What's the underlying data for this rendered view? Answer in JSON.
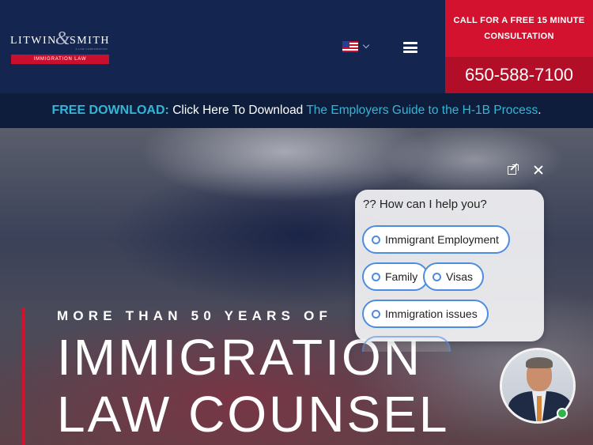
{
  "header": {
    "logo": {
      "name_left": "LITWIN",
      "name_right": "SMITH",
      "ampersand": "&",
      "tagline": "IMMIGRATION LAW",
      "sub": "A LAW CORPORATION"
    },
    "language": {
      "flag": "us-flag-icon",
      "selected": "English"
    },
    "menu_icon": "hamburger-menu-icon",
    "cta": {
      "text": "CALL FOR A FREE 15 MINUTE CONSULTATION",
      "phone": "650-588-7100"
    }
  },
  "download_bar": {
    "label": "FREE DOWNLOAD:",
    "text": "Click Here To Download",
    "link": "The Employers Guide to the H-1B Process",
    "end": "."
  },
  "hero": {
    "kicker": "MORE THAN 50 YEARS OF",
    "title_line1": "IMMIGRATION",
    "title_line2": "LAW COUNSEL"
  },
  "chat": {
    "question": "?? How can I help you?",
    "options": [
      "Immigrant Employment",
      "Family",
      "Visas",
      "Immigration issues"
    ],
    "icons": {
      "open": "open-external-icon",
      "close": "close-icon"
    },
    "agent_status": "online"
  },
  "colors": {
    "navy": "#14264f",
    "red": "#d2122e",
    "teal": "#35b5d6",
    "option_border": "#4c8de0",
    "online": "#2fb34a"
  }
}
